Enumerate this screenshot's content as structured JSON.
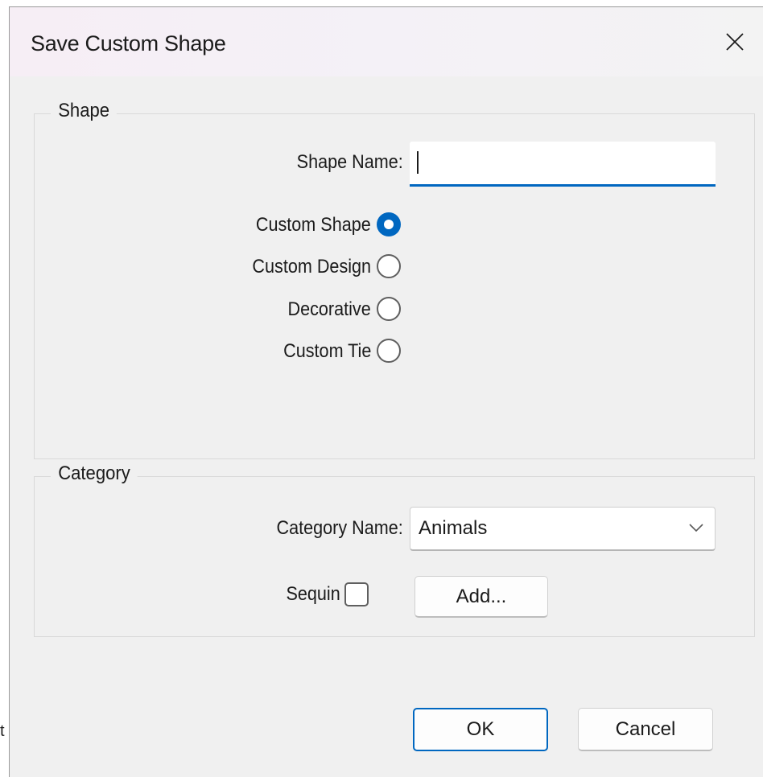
{
  "background": {
    "fragment_text": "t"
  },
  "dialog": {
    "title": "Save Custom Shape",
    "close_icon": "close-icon"
  },
  "shape_group": {
    "legend": "Shape",
    "name_label": "Shape Name:",
    "name_value": "",
    "options": [
      {
        "label": "Custom Shape",
        "checked": true
      },
      {
        "label": "Custom Design",
        "checked": false
      },
      {
        "label": "Decorative",
        "checked": false
      },
      {
        "label": "Custom Tie",
        "checked": false
      }
    ]
  },
  "category_group": {
    "legend": "Category",
    "name_label": "Category Name:",
    "selected_category": "Animals",
    "sequin_label": "Sequin",
    "sequin_checked": false,
    "add_label": "Add..."
  },
  "buttons": {
    "ok_label": "OK",
    "cancel_label": "Cancel"
  },
  "colors": {
    "accent": "#0067c0",
    "dialog_bg": "#f0f0f0"
  }
}
